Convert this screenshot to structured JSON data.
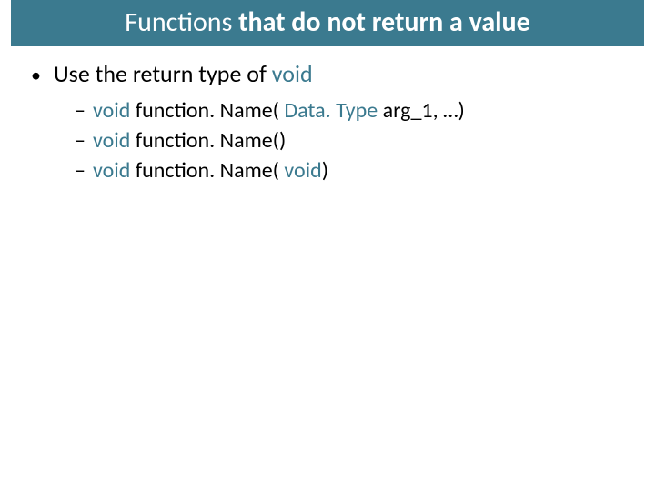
{
  "title": {
    "part1": "Functions ",
    "part2": "that do not return a value"
  },
  "bullets": {
    "l1": {
      "text_pre": "Use the return type of ",
      "kw": "void"
    },
    "sub": [
      {
        "kw1": "void",
        "mid": " function. Name( ",
        "kw2": "Data. Type",
        "post": " arg_1, …)"
      },
      {
        "kw1": "void",
        "mid": " function. Name()"
      },
      {
        "kw1": "void",
        "mid": " function. Name( ",
        "kw2": "void",
        "post": ")"
      }
    ]
  }
}
